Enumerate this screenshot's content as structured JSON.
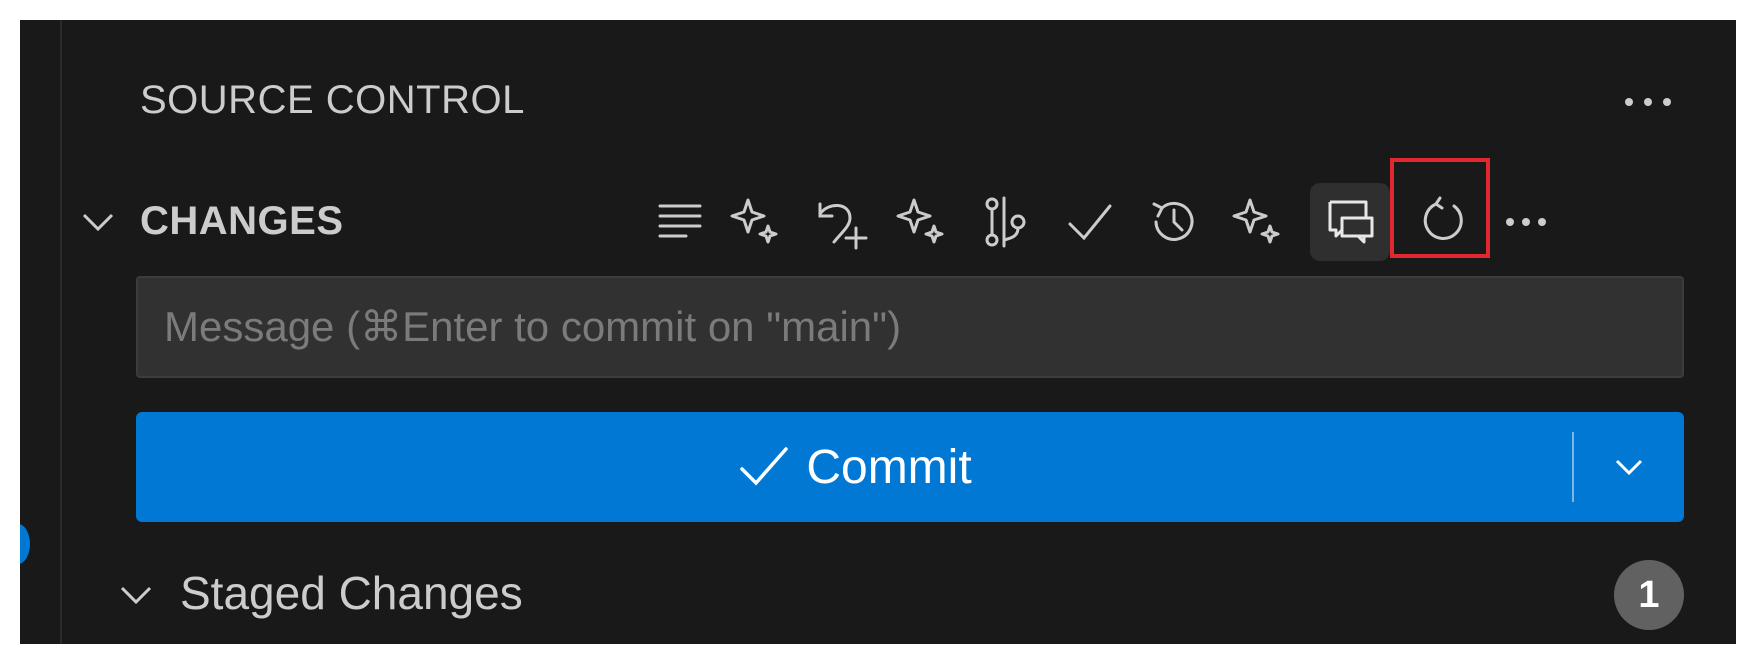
{
  "panel": {
    "title": "SOURCE CONTROL"
  },
  "changes": {
    "label": "CHANGES",
    "toolbar_icons": [
      "list-flat-icon",
      "sparkle-icon",
      "discard-add-icon",
      "sparkle-icon",
      "git-compare-icon",
      "check-icon",
      "history-icon",
      "sparkle-icon",
      "comment-discussion-icon",
      "refresh-icon",
      "more-icon"
    ],
    "active_icon": "comment-discussion-icon"
  },
  "message": {
    "placeholder": "Message (⌘Enter to commit on \"main\")",
    "value": ""
  },
  "commit": {
    "label": "Commit"
  },
  "staged": {
    "label": "Staged Changes",
    "count": "1"
  },
  "colors": {
    "background": "#191919",
    "accent": "#0078d4",
    "highlight": "#e0282e",
    "text": "#cccccc"
  }
}
